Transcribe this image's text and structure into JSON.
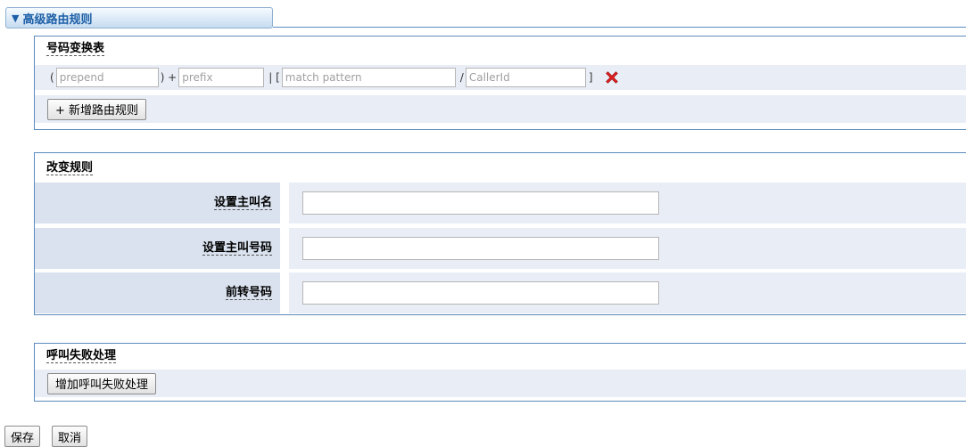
{
  "header": {
    "title": "高级路由规则",
    "toggle_icon": "triangle-down-icon"
  },
  "number_table": {
    "title": "号码变换表",
    "rule": {
      "open_paren": "(",
      "prepend_placeholder": "prepend",
      "close_paren_plus": ") +",
      "prefix_placeholder": "prefix",
      "bar_bracket": "| [",
      "pattern_placeholder": "match pattern",
      "slash": "/",
      "callerid_placeholder": "CallerId",
      "close_bracket": "]",
      "delete_icon": "red-x-delete-icon"
    },
    "add_button": "+ 新增路由规则"
  },
  "change_rules": {
    "title": "改变规则",
    "fields": [
      {
        "label": "设置主叫名",
        "value": ""
      },
      {
        "label": "设置主叫号码",
        "value": ""
      },
      {
        "label": "前转号码",
        "value": ""
      }
    ]
  },
  "failover": {
    "title": "呼叫失败处理",
    "add_button": "增加呼叫失败处理"
  },
  "actions": {
    "save": "保存",
    "cancel": "取消"
  },
  "colors": {
    "border": "#5b8cbf",
    "row_bg": "#e9eef6",
    "label_bg": "#d9e2ee",
    "header_text": "#1d5fa7",
    "delete_red": "#e02020"
  }
}
